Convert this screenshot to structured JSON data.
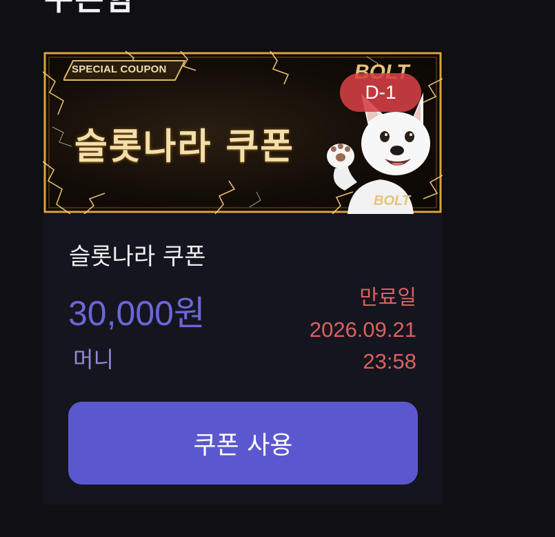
{
  "section": {
    "title": "쿠폰함"
  },
  "coupon": {
    "banner": {
      "tag": "SPECIAL COUPON",
      "title": "슬롯나라 쿠폰",
      "brand": "BOLT",
      "brand_small": "BOLT"
    },
    "dday": "D-1",
    "name": "슬롯나라 쿠폰",
    "amount": "30,000원",
    "amount_type": "머니",
    "expiry": {
      "label": "만료일",
      "date": "2026.09.21",
      "time": "23:58"
    },
    "use_button_label": "쿠폰 사용"
  },
  "colors": {
    "background": "#0f0f14",
    "card": "#15151f",
    "accent": "#5b58cf",
    "amount": "#6c66d8",
    "expiry": "#d9625f",
    "badge": "#d64046"
  },
  "icons": [
    "mascot-dog-icon",
    "lightning-frame-icon"
  ]
}
